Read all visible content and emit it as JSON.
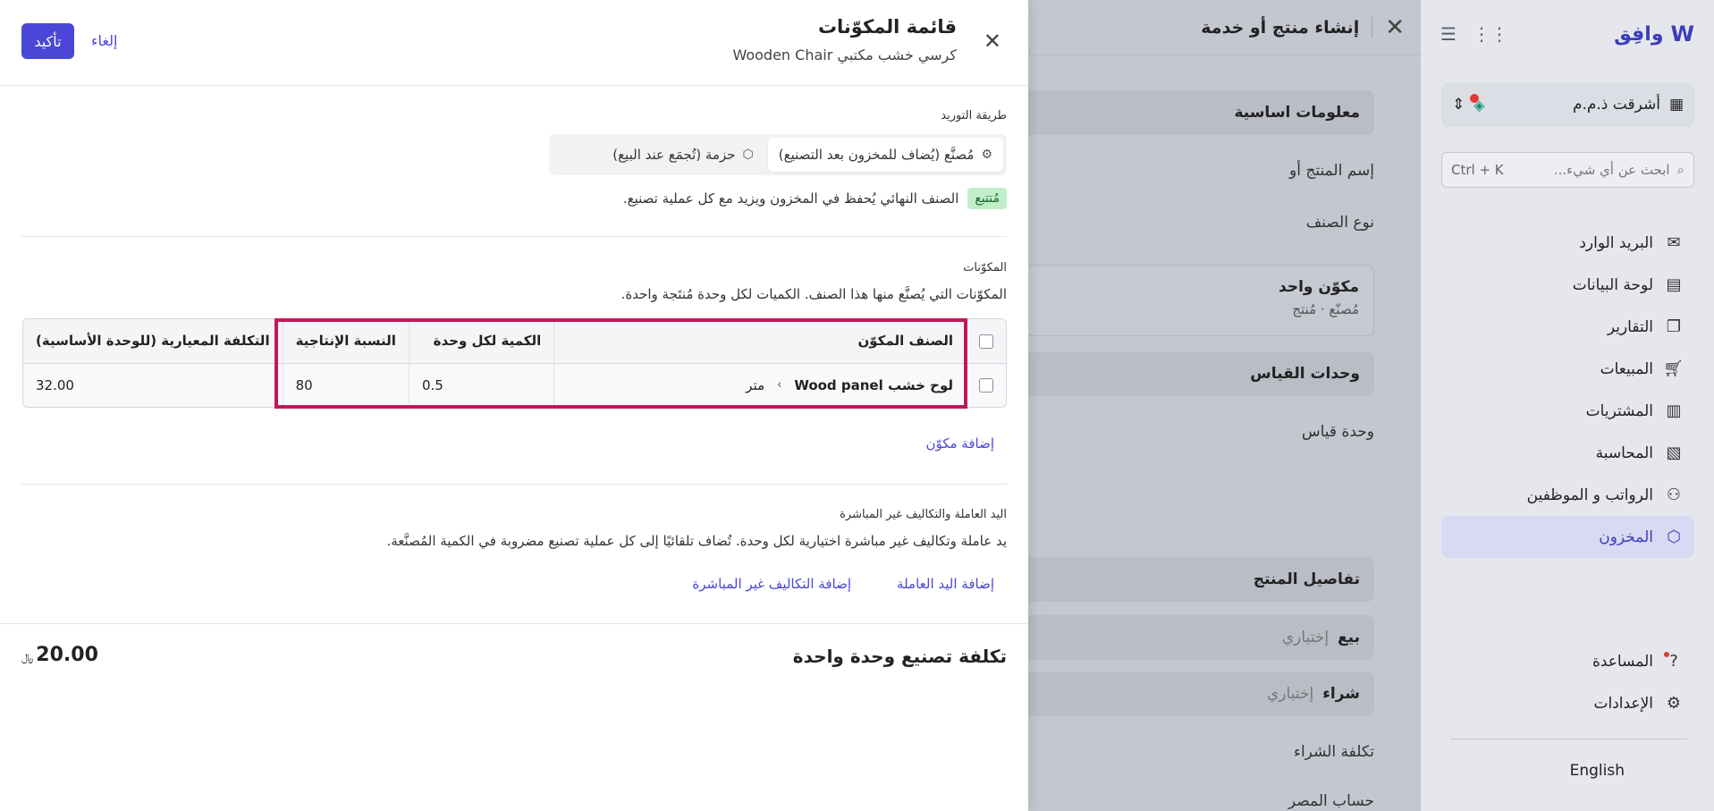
{
  "sidebar": {
    "logo_text": "وافِق",
    "org_name": "أشرقت ذ.م.م",
    "search_placeholder": "ابحث عن أي شيء...",
    "search_shortcut": "Ctrl + K",
    "items": [
      {
        "label": "البريد الوارد",
        "icon": "inbox-icon"
      },
      {
        "label": "لوحة البيانات",
        "icon": "dashboard-icon"
      },
      {
        "label": "التقارير",
        "icon": "reports-icon"
      },
      {
        "label": "المبيعات",
        "icon": "cart-icon"
      },
      {
        "label": "المشتريات",
        "icon": "receipt-icon"
      },
      {
        "label": "المحاسبة",
        "icon": "ledger-icon"
      },
      {
        "label": "الرواتب و الموظفين",
        "icon": "users-icon"
      },
      {
        "label": "المخزون",
        "icon": "box-icon",
        "active": true
      }
    ],
    "bottom_items": [
      {
        "label": "المساعدة",
        "icon": "help-icon"
      },
      {
        "label": "الإعدادات",
        "icon": "gear-icon"
      }
    ],
    "language": "English"
  },
  "create_panel": {
    "title": "إنشاء منتج أو خدمة",
    "section_basic": "معلومات اساسية",
    "name_label": "إسم المنتج أو",
    "type_label": "نوع الصنف",
    "card_title": "مكوّن واحد",
    "card_sub": "مُصنّع · مُنتج",
    "section_units": "وحدات القياس",
    "unit_label": "وحدة قياس",
    "section_details": "تفاصيل المنتج",
    "sell_label": "بيع",
    "sell_optional": "إختياري",
    "buy_label": "شراء",
    "buy_optional": "إختياري",
    "purchase_cost": "تكلفة الشراء",
    "expense_account": "حساب المصر"
  },
  "bom": {
    "title": "قائمة المكوّنات",
    "subtitle": "كرسي خشب مكتبي Wooden Chair",
    "confirm": "تأكيد",
    "cancel": "إلغاء",
    "supply_label": "طريقة التوريد",
    "supply_options": [
      {
        "label": "مُصنَّع (يُضاف للمخزون بعد التصنيع)",
        "selected": true
      },
      {
        "label": "حزمة (تُجمَع عند البيع)",
        "selected": false
      }
    ],
    "stock_tag": "مُتتبع",
    "stock_text": "الصنف النهائي يُحفظ في المخزون ويزيد مع كل عملية تصنيع.",
    "components_label": "المكوّنات",
    "components_desc": "المكوّنات التي يُصنَّع منها هذا الصنف. الكميات لكل وحدة مُنتَجة واحدة.",
    "table": {
      "headers": [
        "الصنف المكوّن",
        "الكمية لكل وحدة",
        "النسبة الإنتاجية",
        "التكلفة المعيارية (للوحدة الأساسية)"
      ],
      "rows": [
        {
          "component": "لوح خشب Wood panel",
          "unit": "متر",
          "qty": "0.5",
          "yield": "80",
          "cost": "32.00"
        }
      ]
    },
    "add_component": "إضافة مكوّن",
    "labor_label": "اليد العاملة والتكاليف غير المباشرة",
    "labor_desc": "يد عاملة وتكاليف غير مباشرة اختيارية لكل وحدة. تُضاف تلقائيًا إلى كل عملية تصنيع مضروبة في الكمية المُصنَّعة.",
    "add_labor": "إضافة اليد العاملة",
    "add_overhead": "إضافة التكاليف غير المباشرة",
    "total_label": "تكلفة تصنيع وحدة واحدة",
    "total_value": "20.00",
    "currency_symbol": "﷼"
  }
}
